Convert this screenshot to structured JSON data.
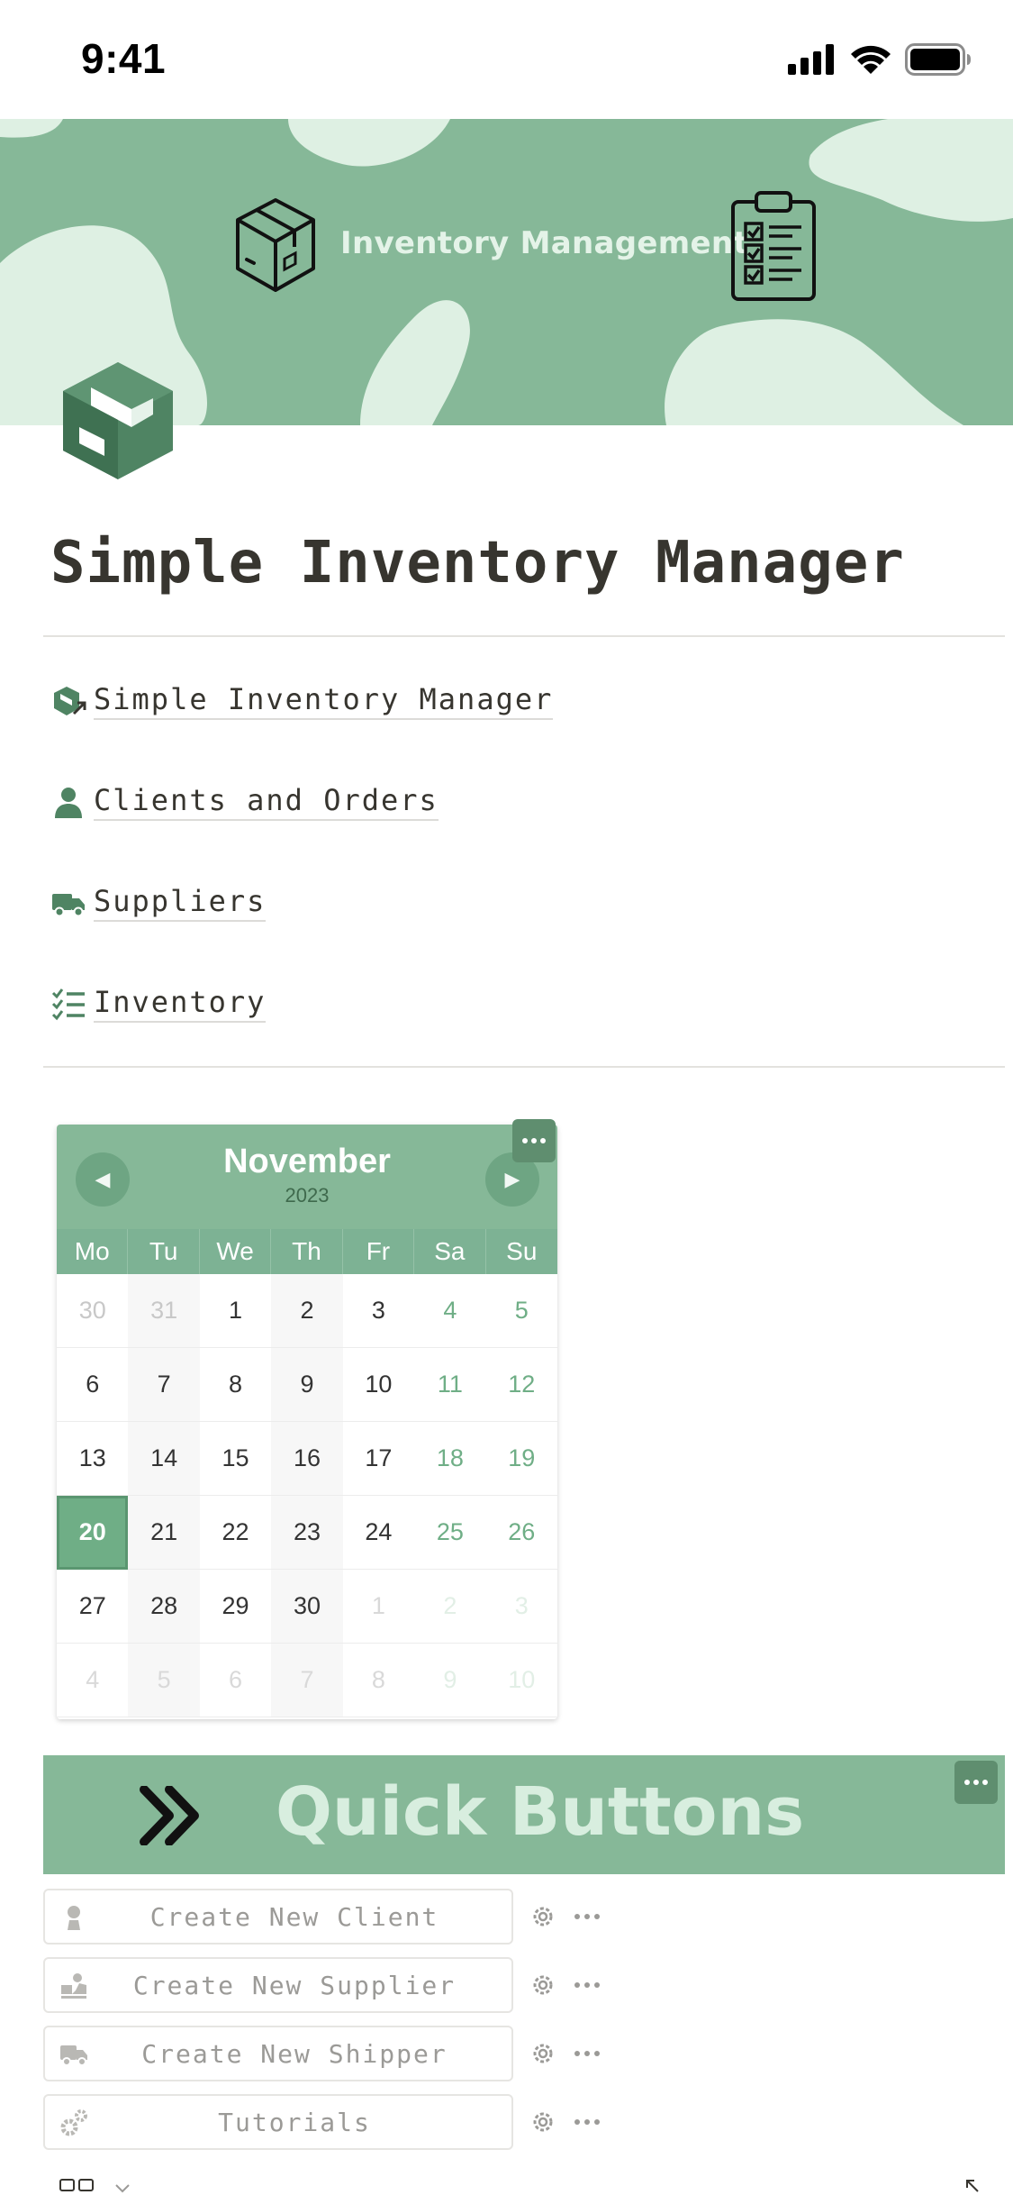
{
  "status_bar": {
    "time": "9:41"
  },
  "cover": {
    "title": "Inventory Management"
  },
  "page": {
    "title": "Simple Inventory Manager"
  },
  "links": [
    {
      "label": "Simple Inventory Manager",
      "icon": "box-arrow-icon"
    },
    {
      "label": "Clients and Orders",
      "icon": "person-icon"
    },
    {
      "label": "Suppliers",
      "icon": "truck-icon"
    },
    {
      "label": "Inventory",
      "icon": "checklist-icon"
    }
  ],
  "calendar": {
    "month": "November",
    "year": "2023",
    "weekdays": [
      "Mo",
      "Tu",
      "We",
      "Th",
      "Fr",
      "Sa",
      "Su"
    ],
    "weeks": [
      [
        "30",
        "31",
        "1",
        "2",
        "3",
        "4",
        "5"
      ],
      [
        "6",
        "7",
        "8",
        "9",
        "10",
        "11",
        "12"
      ],
      [
        "13",
        "14",
        "15",
        "16",
        "17",
        "18",
        "19"
      ],
      [
        "20",
        "21",
        "22",
        "23",
        "24",
        "25",
        "26"
      ],
      [
        "27",
        "28",
        "29",
        "30",
        "1",
        "2",
        "3"
      ],
      [
        "4",
        "5",
        "6",
        "7",
        "8",
        "9",
        "10"
      ]
    ],
    "today": "20"
  },
  "quick_buttons": {
    "title": "Quick Buttons",
    "buttons": [
      {
        "label": "Create New Client",
        "icon": "person-icon"
      },
      {
        "label": "Create New Supplier",
        "icon": "supplier-icon"
      },
      {
        "label": "Create New Shipper",
        "icon": "truck-icon"
      },
      {
        "label": "Tutorials",
        "icon": "gears-icon"
      }
    ]
  },
  "colors": {
    "accent": "#86b898",
    "accent_dark": "#5f8e6f",
    "accent_light": "#def0e3",
    "text": "#37352f"
  }
}
